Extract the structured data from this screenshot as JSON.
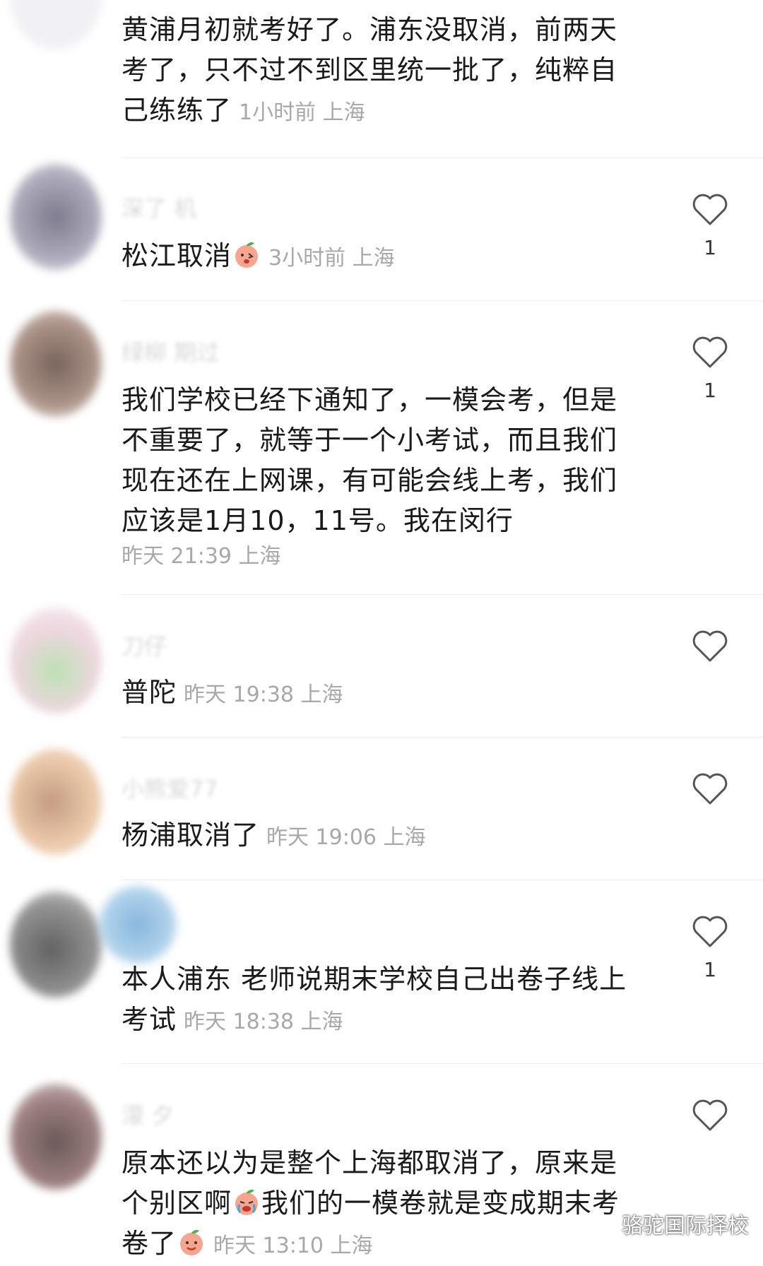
{
  "comments": [
    {
      "username": "",
      "text": "黄浦月初就考好了。浦东没取消，前两天考了，只不过不到区里统一批了，纯粹自己练练了",
      "meta": "1小时前  上海",
      "likes": "",
      "avatar_color": "#e8e8ee"
    },
    {
      "username": "深了  机",
      "text": "松江取消",
      "meta": "3小时前  上海",
      "likes": "1",
      "avatar_color": "#6b6478"
    },
    {
      "username": "绿柳  期过",
      "text": "我们学校已经下通知了，一模会考，但是不重要了，就等于一个小考试，而且我们现在还在上网课，有可能会线上考，我们应该是1月10，11号。我在闵行",
      "meta": "昨天 21:39 上海",
      "likes": "1",
      "avatar_color": "#5a4035"
    },
    {
      "username": "刀仔",
      "text": "普陀",
      "meta": "昨天 19:38 上海",
      "likes": "",
      "avatar_color": "#e9d9e0"
    },
    {
      "username": "小熊爱77",
      "text": "杨浦取消了",
      "meta": "昨天 19:06 上海",
      "likes": "",
      "avatar_color": "#c9946a"
    },
    {
      "username": "",
      "text": "本人浦东 老师说期末学校自己出卷子线上考试",
      "meta": "昨天 18:38 上海",
      "likes": "1",
      "avatar_color": "#3d3d3d"
    },
    {
      "username": "濛 夕",
      "text_a": "原本还以为是整个上海都取消了，原来是个别区啊",
      "text_b": "我们的一模卷就是变成期末考卷了",
      "meta": "昨天 13:10 上海",
      "likes": "",
      "avatar_color": "#4a3535"
    }
  ],
  "watermark": "骆驼国际择校",
  "colors": {
    "text": "#1a1a1a",
    "meta": "#a8a8a8",
    "divider": "#ececec",
    "heart": "#555555"
  },
  "icons": [
    "heart-outline-icon",
    "peach-emoji-icon",
    "crying-peach-emoji-icon",
    "wechat-icon"
  ]
}
